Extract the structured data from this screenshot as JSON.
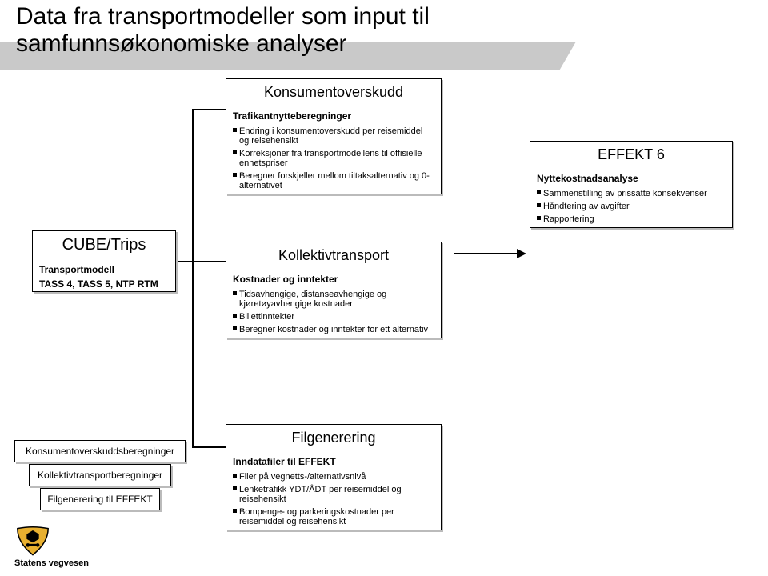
{
  "title_line1": "Data fra transportmodeller som input til",
  "title_line2": "samfunnsøkonomiske analyser",
  "cube": {
    "title": "CUBE/Trips",
    "sub1": "Transportmodell",
    "sub2": "TASS 4, TASS 5, NTP RTM"
  },
  "konsument": {
    "title": "Konsumentoverskudd",
    "sub": "Trafikantnytteberegninger",
    "b1": "Endring i konsumentoverskudd per reisemiddel og reisehensikt",
    "b2": "Korreksjoner fra transportmodellens til offisielle enhetspriser",
    "b3": "Beregner forskjeller mellom tiltaksalternativ og 0-alternativet"
  },
  "kollektiv": {
    "title": "Kollektivtransport",
    "sub": "Kostnader og inntekter",
    "b1": "Tidsavhengige, distanseavhengige og kjøretøyavhengige kostnader",
    "b2": "Billettinntekter",
    "b3": "Beregner kostnader og inntekter for ett alternativ"
  },
  "filgen": {
    "title": "Filgenerering",
    "sub": "Inndatafiler til EFFEKT",
    "b1": "Filer på vegnetts-/alternativsnivå",
    "b2": "Lenketrafikk YDT/ÅDT per reisemiddel og reisehensikt",
    "b3": "Bompenge- og parkeringskostnader per reisemiddel og reisehensikt"
  },
  "effekt": {
    "title": "EFFEKT 6",
    "sub": "Nyttekostnadsanalyse",
    "b1": "Sammenstilling av prissatte konsekvenser",
    "b2": "Håndtering av avgifter",
    "b3": "Rapportering"
  },
  "mini1": "Konsumentoverskuddsberegninger",
  "mini2": "Kollektivtransportberegninger",
  "mini3": "Filgenerering til EFFEKT",
  "logo_text": "Statens vegvesen"
}
